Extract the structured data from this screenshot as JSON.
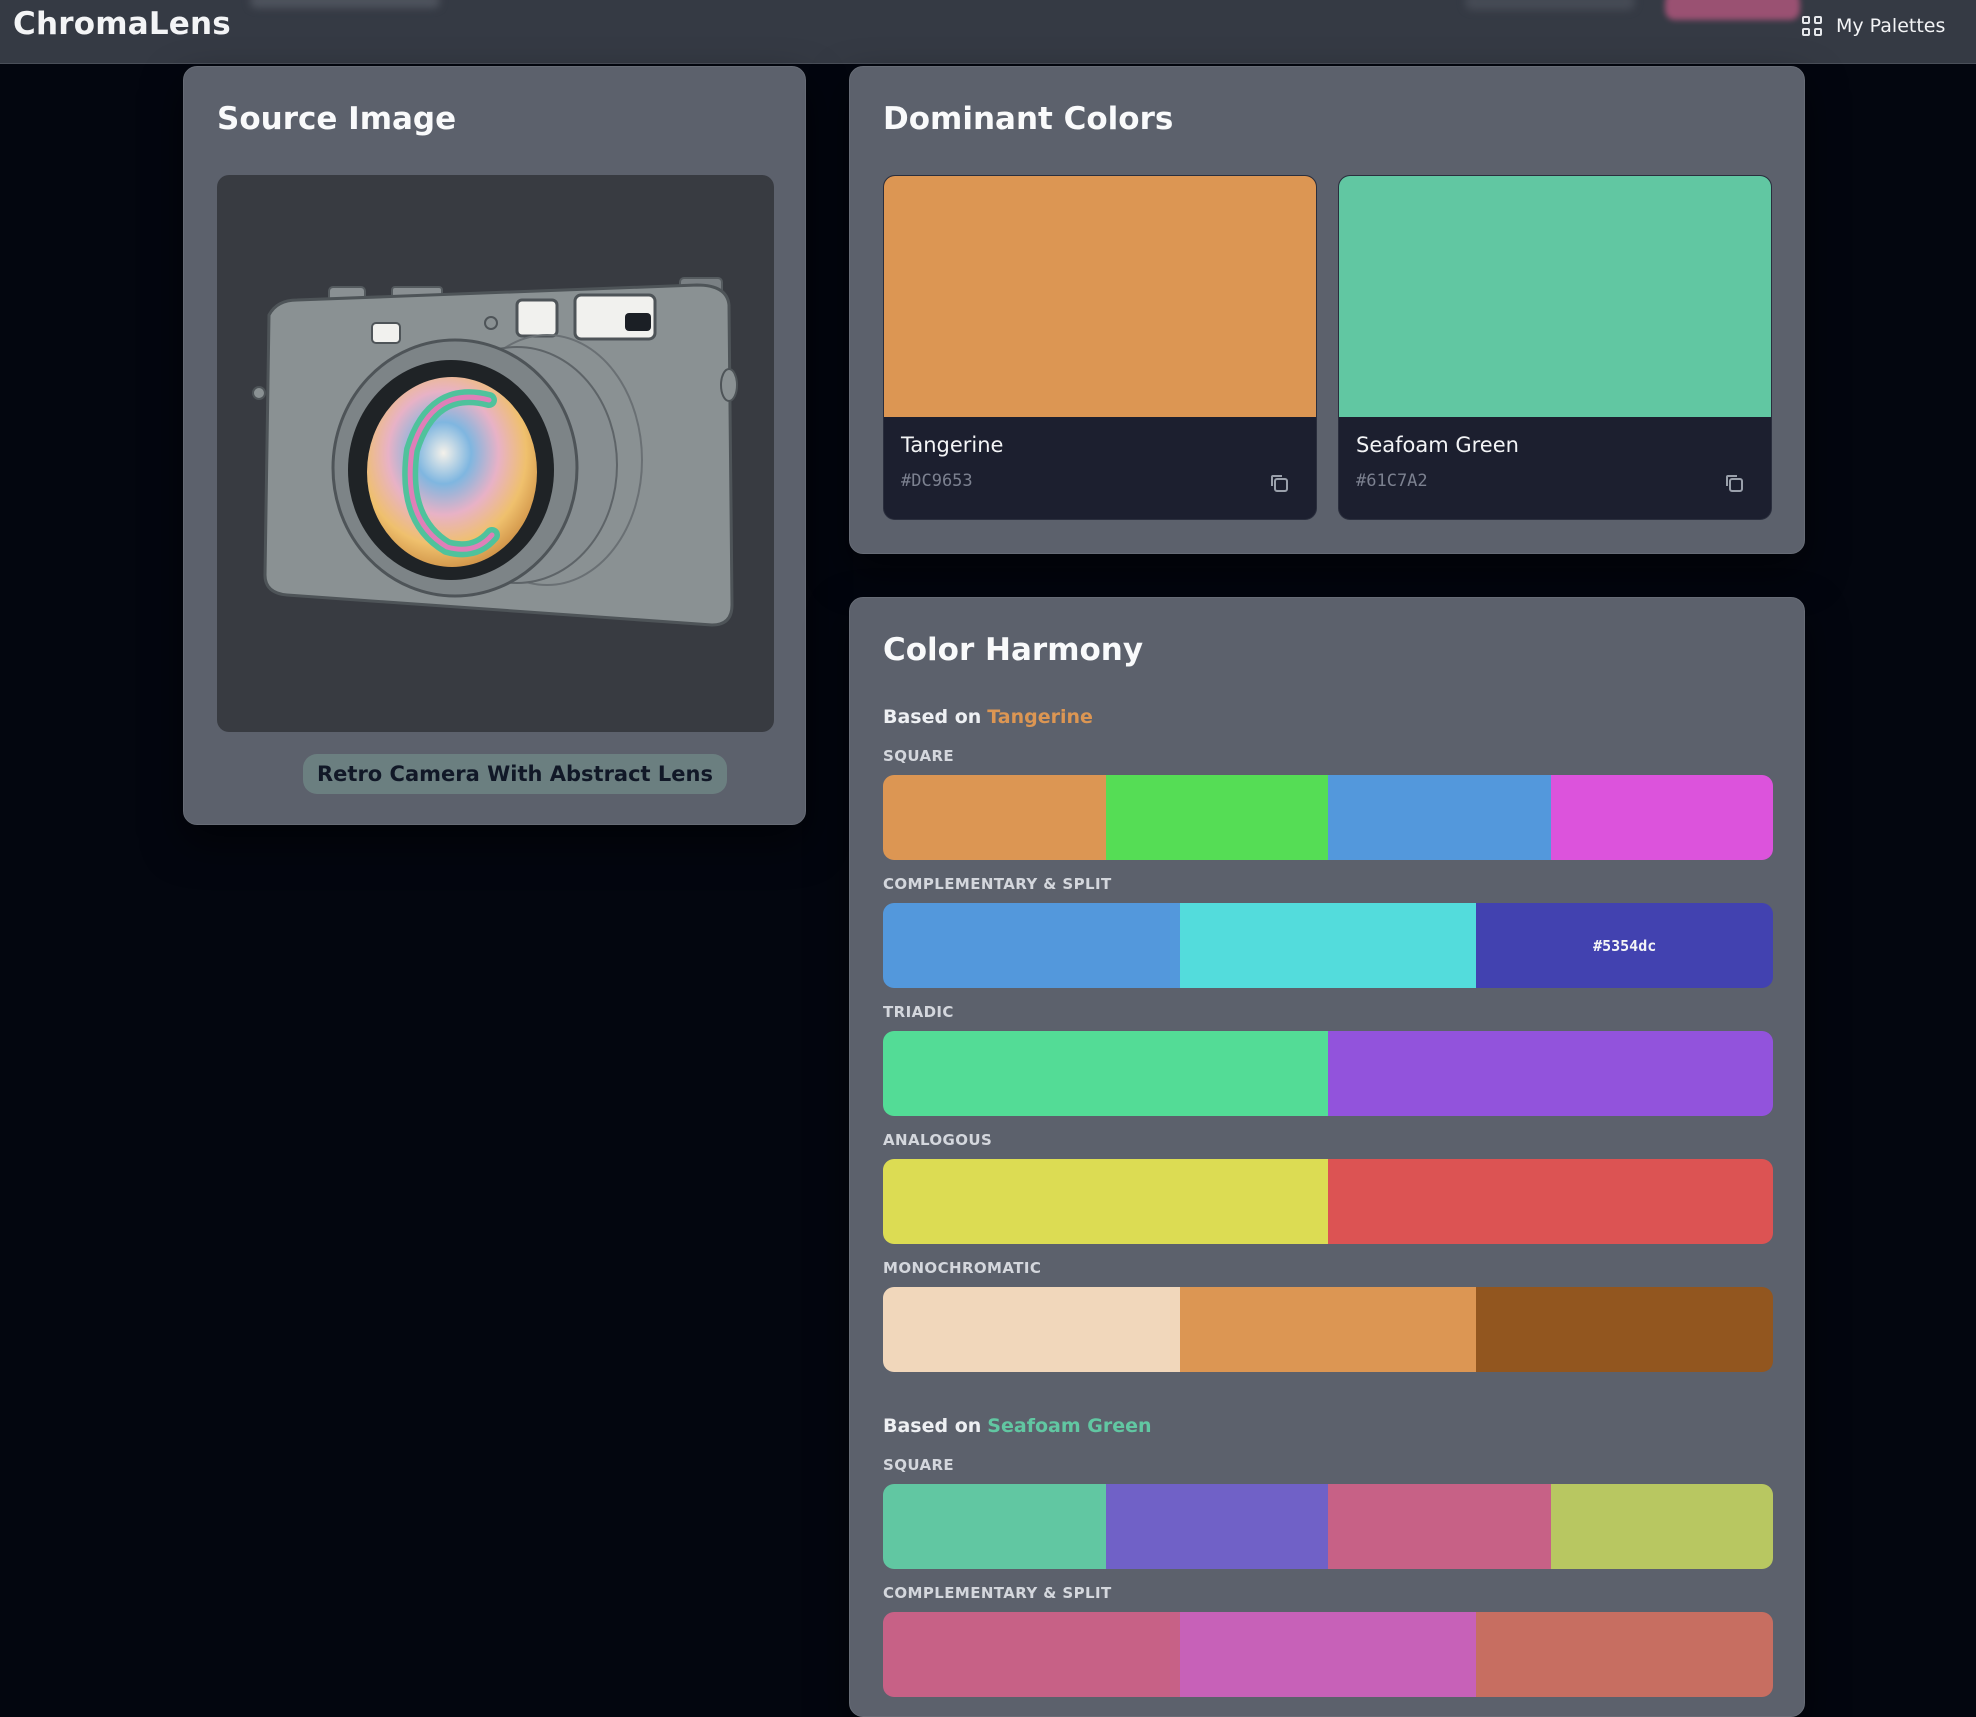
{
  "app": {
    "brand": "ChromaLens"
  },
  "nav": {
    "my_palettes": "My Palettes"
  },
  "source": {
    "title": "Source Image",
    "caption": "Retro Camera With Abstract Lens"
  },
  "dominant": {
    "title": "Dominant Colors",
    "colors": [
      {
        "name": "Tangerine",
        "hex": "#DC9653",
        "color": "#dc9653"
      },
      {
        "name": "Seafoam Green",
        "hex": "#61C7A2",
        "color": "#61c7a2"
      }
    ]
  },
  "harmony": {
    "title": "Color Harmony",
    "based_prefix": "Based on",
    "groups": [
      {
        "base_name": "Tangerine",
        "base_color": "#dc9653",
        "schemes": [
          {
            "label": "SQUARE",
            "colors": [
              "#dc9653",
              "#55dd55",
              "#5398dc",
              "#dc53dc"
            ]
          },
          {
            "label": "COMPLEMENTARY & SPLIT",
            "colors": [
              "#5398dc",
              "#53dcdc",
              "#4242b0"
            ],
            "hover_label": "#5354dc"
          },
          {
            "label": "TRIADIC",
            "colors": [
              "#53dc96",
              "#9253dc"
            ]
          },
          {
            "label": "ANALOGOUS",
            "colors": [
              "#dcdc53",
              "#dc5353"
            ]
          },
          {
            "label": "MONOCHROMATIC",
            "colors": [
              "#f1d7bb",
              "#dc9653",
              "#92561f"
            ]
          }
        ]
      },
      {
        "base_name": "Seafoam Green",
        "base_color": "#61c7a2",
        "schemes": [
          {
            "label": "SQUARE",
            "colors": [
              "#61c7a2",
              "#7061c7",
              "#c76186",
              "#b8c761"
            ]
          },
          {
            "label": "COMPLEMENTARY & SPLIT",
            "colors": [
              "#c76186",
              "#c761b8",
              "#c76e61"
            ]
          }
        ]
      }
    ]
  }
}
